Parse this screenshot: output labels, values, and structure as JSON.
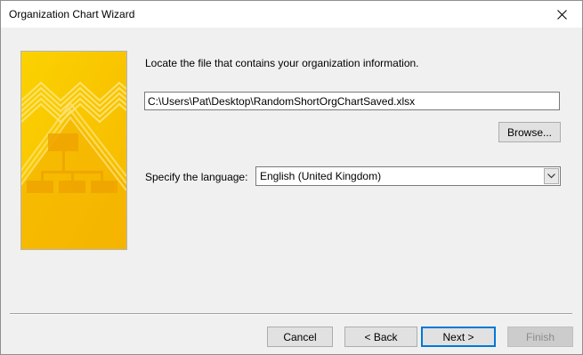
{
  "window": {
    "title": "Organization Chart Wizard"
  },
  "main": {
    "instruction": "Locate the file that contains your organization information.",
    "file_path": "C:\\Users\\Pat\\Desktop\\RandomShortOrgChartSaved.xlsx",
    "browse_label": "Browse...",
    "language_label": "Specify the language:",
    "language_value": "English (United Kingdom)"
  },
  "footer": {
    "cancel_label": "Cancel",
    "back_label": "< Back",
    "next_label": "Next >",
    "finish_label": "Finish"
  },
  "icons": {
    "close": "close-icon",
    "dropdown": "chevron-down-icon",
    "banner": "org-chart-illustration"
  },
  "colors": {
    "accent": "#0078d7",
    "banner_yellow": "#f9c400"
  }
}
